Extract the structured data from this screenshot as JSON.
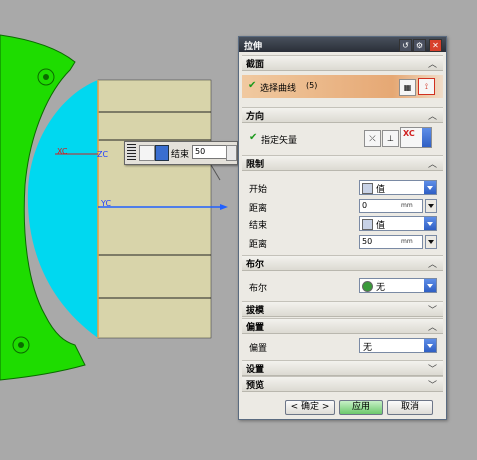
{
  "colors": {
    "accent_orange": "#e6a874",
    "dropdown_blue": "#2f5fc4",
    "model_green": "#1edc00",
    "model_cyan": "#00d8f0",
    "plane_khaki": "#d8d4aa",
    "close_red": "#d8402c"
  },
  "viewport": {
    "axis_labels": {
      "xc": "XC",
      "zc": "ZC",
      "yc": "YC"
    },
    "mini_toolbar": {
      "label": "结束",
      "value": "50"
    }
  },
  "dialog": {
    "title": "拉伸",
    "sections": {
      "section": {
        "title": "截面",
        "select_curve_label": "选择曲线",
        "select_curve_count": "(5)"
      },
      "direction": {
        "title": "方向",
        "specify_vector_label": "指定矢量",
        "vector_option": "XC"
      },
      "limits": {
        "title": "限制",
        "start_label": "开始",
        "start_value": "值",
        "start_distance_label": "距离",
        "start_distance_value": "0",
        "end_label": "结束",
        "end_value": "值",
        "end_distance_label": "距离",
        "end_distance_value": "50",
        "unit": "mm"
      },
      "boolean": {
        "title": "布尔",
        "boolean_label": "布尔",
        "boolean_value": "无"
      },
      "draft": {
        "title": "拔模"
      },
      "offset": {
        "title": "偏置",
        "offset_label": "偏置",
        "offset_value": "无"
      },
      "settings": {
        "title": "设置"
      },
      "preview": {
        "title": "预览"
      }
    },
    "buttons": {
      "ok": "< 确定 >",
      "apply": "应用",
      "cancel": "取消"
    }
  }
}
